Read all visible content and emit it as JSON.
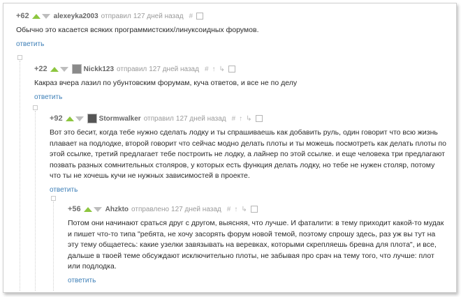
{
  "comments": [
    {
      "rating": "+62",
      "author": "alexeyka2003",
      "sent": "отправил",
      "time": "127 дней назад",
      "text": "Обычно это касается всяких программистских/линуксоидных форумов.",
      "reply": "ответить"
    },
    {
      "rating": "+22",
      "author": "Nickk123",
      "sent": "отправил",
      "time": "127 дней назад",
      "text": "Какраз вчера лазил по убунтовским форумам, куча ответов, и все не по делу",
      "reply": "ответить"
    },
    {
      "rating": "+92",
      "author": "Stormwalker",
      "sent": "отправил",
      "time": "127 дней назад",
      "text": "Вот это бесит, когда тебе нужно сделать лодку и ты спрашиваешь как добавить руль, один говорит что всю жизнь плавает на подлодке, второй говорит что сейчас модно делать плоты и ты можешь посмотреть как делать плоты по этой ссылке, третий предлагает тебе построить не лодку, а лайнер по этой ссылке. и еще человека три предлагают позвать разных сомнительных столяров, у которых есть функция делать лодку, но тебе не нужен столяр, потому что ты не хочешь кучи не нужных зависимостей в проекте.",
      "reply": "ответить"
    },
    {
      "rating": "+56",
      "author": "Ahzkto",
      "sent": "отправлено",
      "time": "127 дней назад",
      "text": "Потом они начинают сраться друг с другом, выясняя, что лучше. И фаталити: в тему приходит какой-то мудак и пишет что-то типа \"ребята, не хочу засорять форум новой темой, поэтому спрошу здесь, раз уж вы тут на эту тему общаетесь: какие узелки завязывать на веревках, которыми скрепляешь бревна для плота\", и все, дальше в твоей теме обсуждают исключительно плоты, не забывая про срач на тему того, что лучше: плот или подлодка.",
      "reply": "ответить"
    }
  ],
  "colors": {
    "up": "#8dc63f",
    "down": "#bdbdbd",
    "link": "#3d7fb7"
  }
}
